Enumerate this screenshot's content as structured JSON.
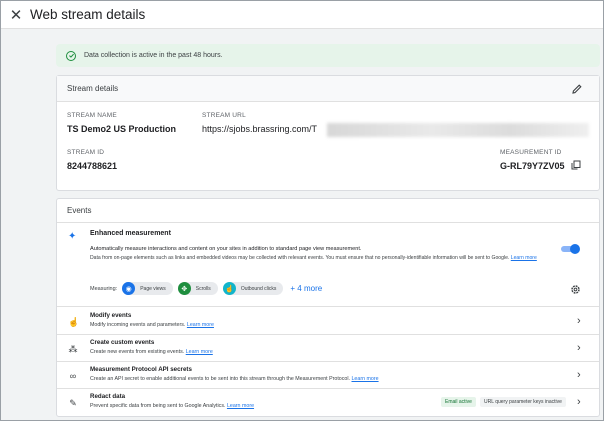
{
  "header": {
    "title": "Web stream details",
    "close_icon": "close-icon"
  },
  "banner": {
    "text": "Data collection is active in the past 48 hours."
  },
  "stream_details": {
    "heading": "Stream details",
    "stream_name_label": "STREAM NAME",
    "stream_name": "TS Demo2 US Production",
    "stream_url_label": "STREAM URL",
    "stream_url": "https://sjobs.brassring.com/T",
    "stream_id_label": "STREAM ID",
    "stream_id": "8244788621",
    "measurement_id_label": "MEASUREMENT ID",
    "measurement_id": "G-RL79Y7ZV05"
  },
  "events": {
    "heading": "Events",
    "enhanced": {
      "title": "Enhanced measurement",
      "description": "Automatically measure interactions and content on your sites in addition to standard page view measurement.",
      "note": "Data from on-page elements such as links and embedded videos may be collected with relevant events. You must ensure that no personally-identifiable information will be sent to Google.",
      "learn_more": "Learn more",
      "enabled": true,
      "measuring_label": "Measuring:",
      "chips": [
        {
          "label": "Page views",
          "icon": "eye-icon",
          "color": "#1a73e8"
        },
        {
          "label": "Scrolls",
          "icon": "scroll-arrows-icon",
          "color": "#1e8e3e"
        },
        {
          "label": "Outbound clicks",
          "icon": "click-icon",
          "color": "#12b5cb"
        }
      ],
      "more": "+ 4 more"
    },
    "rows": [
      {
        "title": "Modify events",
        "desc": "Modify incoming events and parameters.",
        "link": "Learn more"
      },
      {
        "title": "Create custom events",
        "desc": "Create new events from existing events.",
        "link": "Learn more"
      },
      {
        "title": "Measurement Protocol API secrets",
        "desc": "Create an API secret to enable additional events to be sent into this stream through the Measurement Protocol.",
        "link": "Learn more"
      },
      {
        "title": "Redact data",
        "desc": "Prevent specific data from being sent to Google Analytics.",
        "link": "Learn more",
        "badge_active": "Email active",
        "badge_inactive": "URL query parameter keys inactive"
      }
    ]
  },
  "colors": {
    "accent": "#1a73e8",
    "success": "#1e8e3e",
    "banner_bg": "#e6f4ea"
  }
}
